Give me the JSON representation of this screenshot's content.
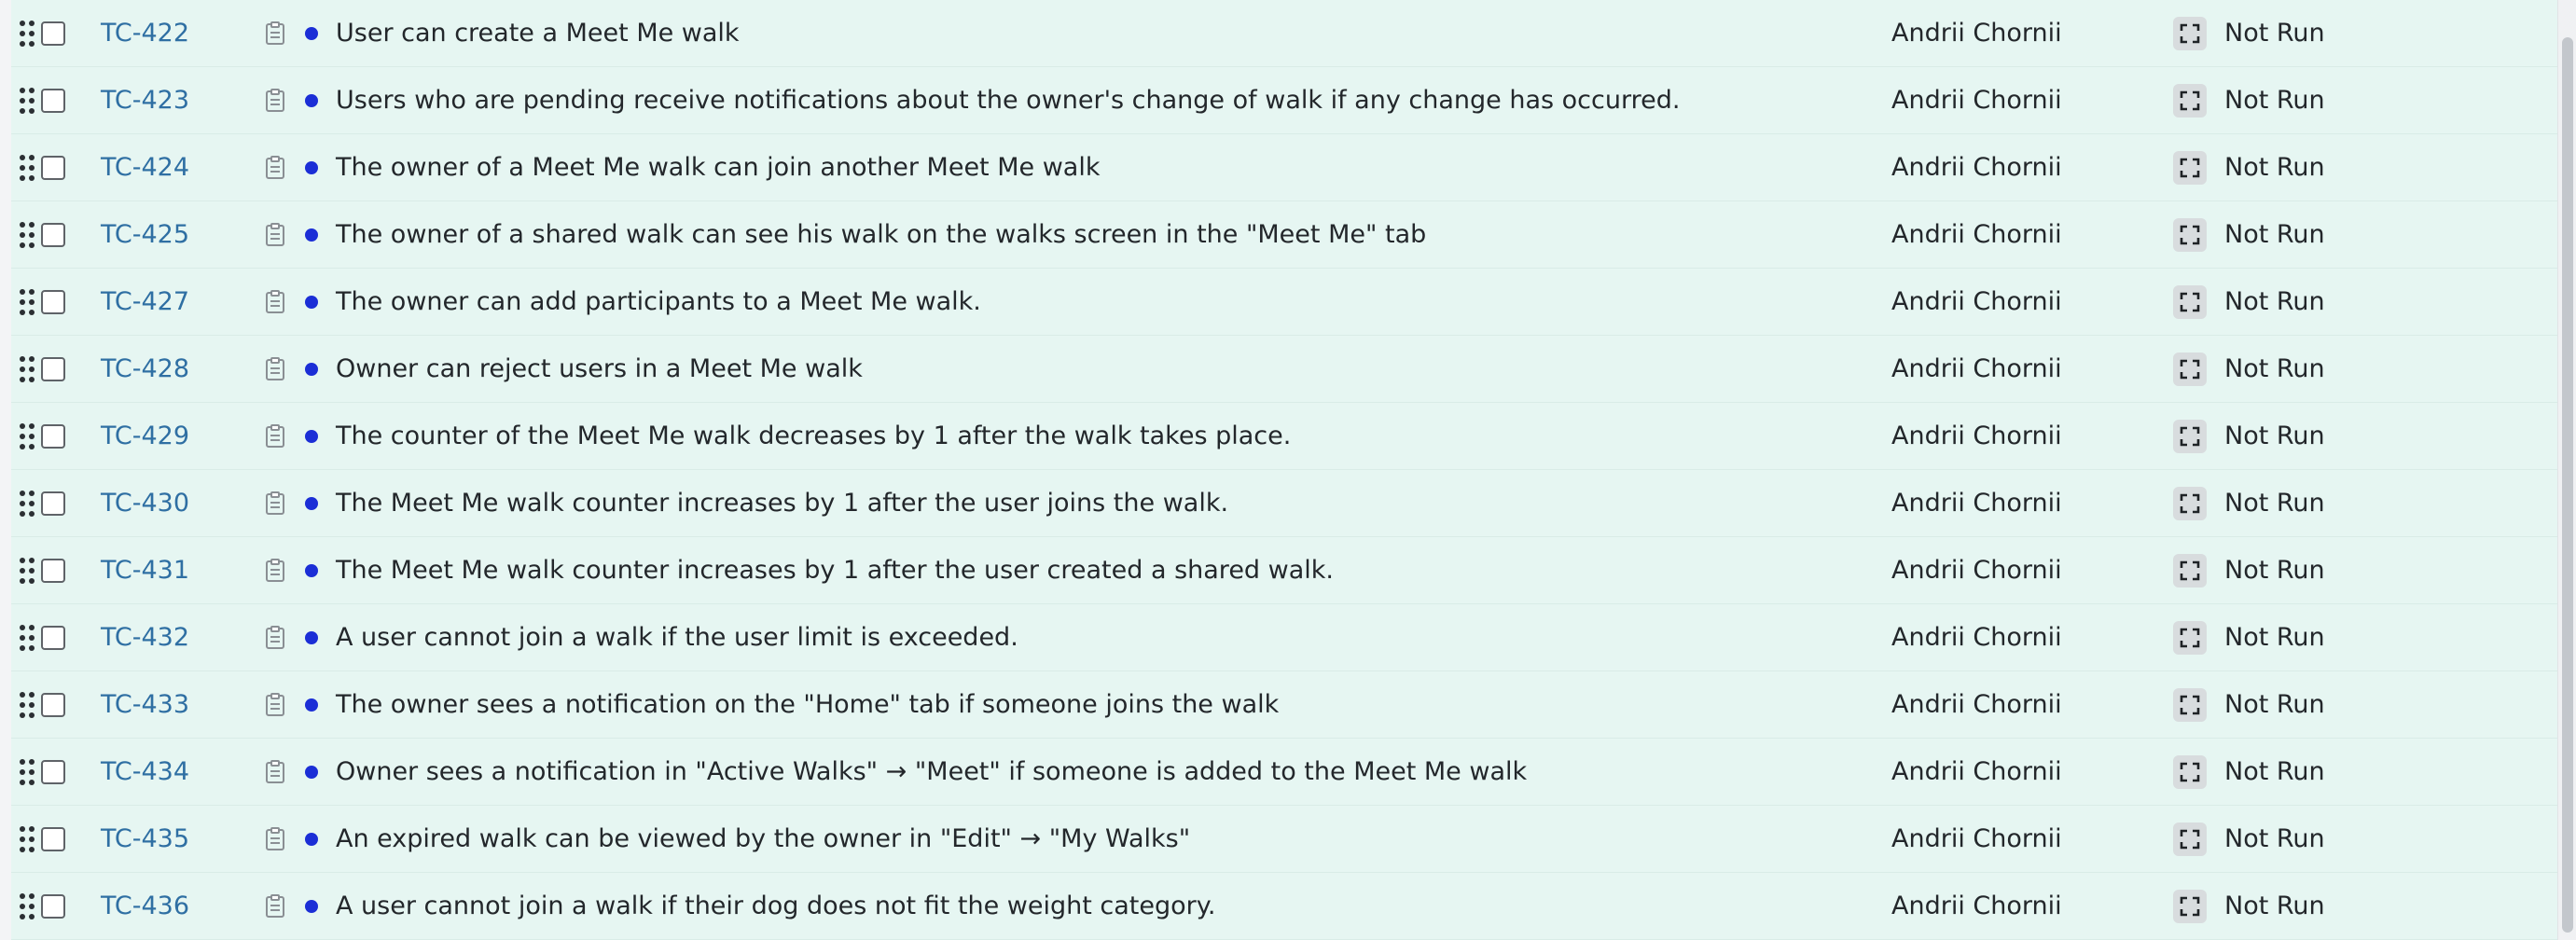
{
  "rows": [
    {
      "id": "TC-422",
      "title": "User can create a Meet Me walk",
      "owner": "Andrii Chornii",
      "status": "Not Run"
    },
    {
      "id": "TC-423",
      "title": "Users who are pending receive notifications about the owner's change of walk if any change has occurred.",
      "owner": "Andrii Chornii",
      "status": "Not Run"
    },
    {
      "id": "TC-424",
      "title": "The owner of a Meet Me walk can join another Meet Me walk",
      "owner": "Andrii Chornii",
      "status": "Not Run"
    },
    {
      "id": "TC-425",
      "title": "The owner of a shared walk can see his walk on the walks screen in the \"Meet Me\" tab",
      "owner": "Andrii Chornii",
      "status": "Not Run"
    },
    {
      "id": "TC-427",
      "title": "The owner can add participants to a Meet Me walk.",
      "owner": "Andrii Chornii",
      "status": "Not Run"
    },
    {
      "id": "TC-428",
      "title": "Owner can reject users in a Meet Me walk",
      "owner": "Andrii Chornii",
      "status": "Not Run"
    },
    {
      "id": "TC-429",
      "title": "The counter of the Meet Me walk decreases by 1 after the walk takes place.",
      "owner": "Andrii Chornii",
      "status": "Not Run"
    },
    {
      "id": "TC-430",
      "title": "The Meet Me walk counter increases by 1 after the user joins the walk.",
      "owner": "Andrii Chornii",
      "status": "Not Run"
    },
    {
      "id": "TC-431",
      "title": "The Meet Me walk counter increases by 1 after the user created a shared walk.",
      "owner": "Andrii Chornii",
      "status": "Not Run"
    },
    {
      "id": "TC-432",
      "title": "A user cannot join a walk if the user limit is exceeded.",
      "owner": "Andrii Chornii",
      "status": "Not Run"
    },
    {
      "id": "TC-433",
      "title": "The owner sees a notification on the \"Home\" tab if someone joins the walk",
      "owner": "Andrii Chornii",
      "status": "Not Run"
    },
    {
      "id": "TC-434",
      "title": "Owner sees a notification in \"Active Walks\" → \"Meet\" if someone is added to the Meet Me walk",
      "owner": "Andrii Chornii",
      "status": "Not Run"
    },
    {
      "id": "TC-435",
      "title": "An expired walk can be viewed by the owner in \"Edit\" → \"My Walks\"",
      "owner": "Andrii Chornii",
      "status": "Not Run"
    },
    {
      "id": "TC-436",
      "title": "A user cannot join a walk if their dog does not fit the weight category.",
      "owner": "Andrii Chornii",
      "status": "Not Run"
    }
  ],
  "icons": {
    "drag": "drag-handle-icon",
    "checkbox": "checkbox",
    "clipboard": "clipboard-icon",
    "priority_dot": "priority-dot-icon",
    "status": "status-focus-icon"
  },
  "colors": {
    "row_background": "#e6f6f2",
    "id_link": "#2f6fa3",
    "priority_dot": "#1b2ed6"
  }
}
